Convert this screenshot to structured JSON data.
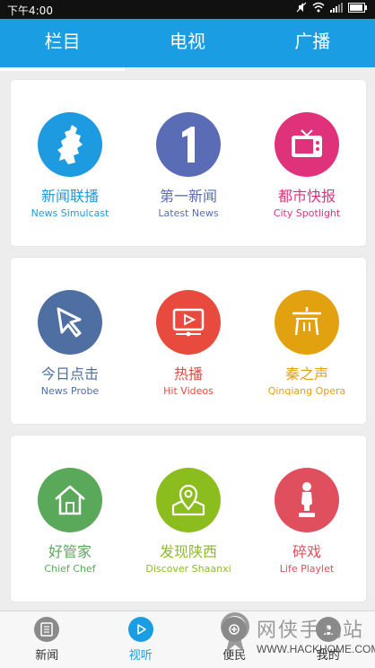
{
  "status_bar": {
    "time": "下午4:00"
  },
  "tabs": [
    {
      "label": "栏目",
      "active": true
    },
    {
      "label": "电视",
      "active": false
    },
    {
      "label": "广播",
      "active": false
    }
  ],
  "cards": [
    {
      "items": [
        {
          "cn": "新闻联播",
          "en": "News Simulcast",
          "color": "#1e9be0",
          "icon": "shaanxi-map-icon"
        },
        {
          "cn": "第一新闻",
          "en": "Latest News",
          "color": "#5b6cb6",
          "icon": "number-one-icon"
        },
        {
          "cn": "都市快报",
          "en": "City Spotlight",
          "color": "#e0327a",
          "icon": "tv-icon"
        }
      ]
    },
    {
      "items": [
        {
          "cn": "今日点击",
          "en": "News Probe",
          "color": "#4f6fa3",
          "icon": "cursor-icon"
        },
        {
          "cn": "热播",
          "en": "Hit Videos",
          "color": "#e84a3d",
          "icon": "play-screen-icon"
        },
        {
          "cn": "秦之声",
          "en": "Qinqiang Opera",
          "color": "#e2a20f",
          "icon": "pavilion-icon"
        }
      ]
    },
    {
      "items": [
        {
          "cn": "好管家",
          "en": "Chief Chef",
          "color": "#5aa95a",
          "icon": "house-icon"
        },
        {
          "cn": "发现陕西",
          "en": "Discover Shaanxi",
          "color": "#8cbd1e",
          "icon": "map-pin-icon"
        },
        {
          "cn": "碎戏",
          "en": "Life Playlet",
          "color": "#e04f5d",
          "icon": "figure-icon"
        }
      ]
    }
  ],
  "bottom_nav": [
    {
      "label": "新闻",
      "active": false,
      "icon": "document-icon"
    },
    {
      "label": "视听",
      "active": true,
      "icon": "play-icon"
    },
    {
      "label": "便民",
      "active": false,
      "icon": "convenience-icon"
    },
    {
      "label": "我的",
      "active": false,
      "icon": "profile-icon"
    }
  ],
  "watermark": {
    "text": "网侠手机站",
    "url": "WWW.HACKHOME.COM"
  }
}
